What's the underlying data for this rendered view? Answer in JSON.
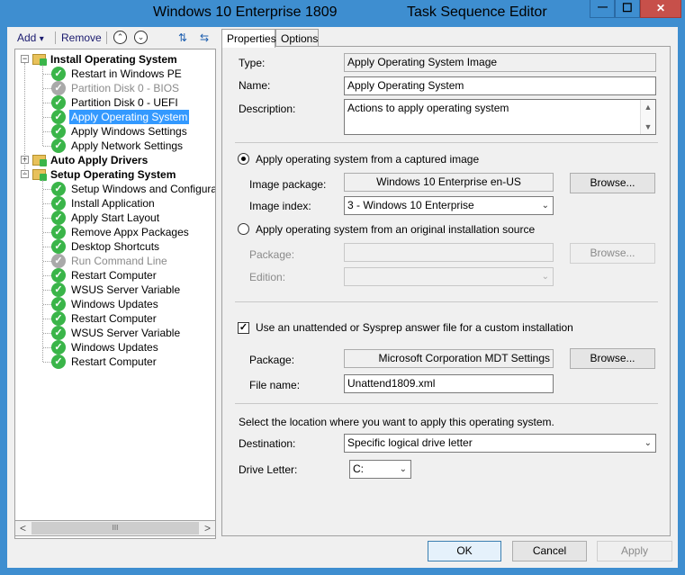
{
  "window": {
    "title_left": "Windows 10 Enterprise 1809",
    "title_right": "Task Sequence Editor",
    "minimize_glyph": "—",
    "maximize_glyph": "☐",
    "close_glyph": "✕"
  },
  "toolbar": {
    "add_label": "Add",
    "add_caret": "▾",
    "remove_label": "Remove",
    "move_up_glyph": "⌃",
    "move_down_glyph": "⌄",
    "icon_a": "⇅",
    "icon_b": "⇆"
  },
  "tree": {
    "expand_glyph": "−",
    "collapse_glyph": "+",
    "check_glyph": "✓",
    "rows": [
      {
        "label": "Install Operating System",
        "type": "group",
        "state": "expanded"
      },
      {
        "label": "Restart in Windows PE",
        "type": "step",
        "status": "ok"
      },
      {
        "label": "Partition Disk 0 - BIOS",
        "type": "step",
        "status": "disabled"
      },
      {
        "label": "Partition Disk 0 - UEFI",
        "type": "step",
        "status": "ok"
      },
      {
        "label": "Apply Operating System",
        "type": "step",
        "status": "ok",
        "selected": true
      },
      {
        "label": "Apply Windows Settings",
        "type": "step",
        "status": "ok"
      },
      {
        "label": "Apply Network Settings",
        "type": "step",
        "status": "ok"
      },
      {
        "label": "Auto Apply Drivers",
        "type": "group",
        "state": "collapsed"
      },
      {
        "label": "Setup Operating System",
        "type": "group",
        "state": "expanded"
      },
      {
        "label": "Setup Windows and Configuration",
        "type": "step",
        "status": "ok"
      },
      {
        "label": "Install Application",
        "type": "step",
        "status": "ok"
      },
      {
        "label": "Apply Start Layout",
        "type": "step",
        "status": "ok"
      },
      {
        "label": "Remove Appx Packages",
        "type": "step",
        "status": "ok"
      },
      {
        "label": "Desktop Shortcuts",
        "type": "step",
        "status": "ok"
      },
      {
        "label": "Run Command Line",
        "type": "step",
        "status": "disabled"
      },
      {
        "label": "Restart Computer",
        "type": "step",
        "status": "ok"
      },
      {
        "label": "WSUS Server Variable",
        "type": "step",
        "status": "ok"
      },
      {
        "label": "Windows Updates",
        "type": "step",
        "status": "ok"
      },
      {
        "label": "Restart Computer",
        "type": "step",
        "status": "ok"
      },
      {
        "label": "WSUS Server Variable",
        "type": "step",
        "status": "ok"
      },
      {
        "label": "Windows Updates",
        "type": "step",
        "status": "ok"
      },
      {
        "label": "Restart Computer",
        "type": "step",
        "status": "ok"
      }
    ],
    "scroll_left": "<",
    "scroll_right": ">",
    "scroll_grip": "III"
  },
  "tabs": {
    "properties": "Properties",
    "options": "Options"
  },
  "properties": {
    "type_label": "Type:",
    "type_value": "Apply Operating System Image",
    "name_label": "Name:",
    "name_value": "Apply Operating System",
    "description_label": "Description:",
    "description_value": "Actions to apply operating system",
    "scroll_up": "▲",
    "scroll_down": "▼",
    "radio_captured": "Apply operating system from a captured image",
    "image_package_label": "Image package:",
    "image_package_value": "Windows 10 Enterprise  en-US",
    "browse_label": "Browse...",
    "image_index_label": "Image index:",
    "image_index_value": "3 - Windows 10 Enterprise",
    "radio_original": "Apply operating system from an original installation source",
    "package_label_dim": "Package:",
    "edition_label": "Edition:",
    "unattend_label": "Use an unattended or Sysprep answer file for a custom installation",
    "unattend_checked": true,
    "checkbox_glyph": "✓",
    "package_label": "Package:",
    "package_value": "Microsoft Corporation MDT Settings",
    "file_name_label": "File name:",
    "file_name_value": "Unattend1809.xml",
    "location_text": "Select the location where you want to apply this operating system.",
    "destination_label": "Destination:",
    "destination_value": "Specific logical drive letter",
    "drive_letter_label": "Drive Letter:",
    "drive_letter_value": "C:",
    "caret": "⌄"
  },
  "footer": {
    "ok": "OK",
    "cancel": "Cancel",
    "apply": "Apply"
  }
}
